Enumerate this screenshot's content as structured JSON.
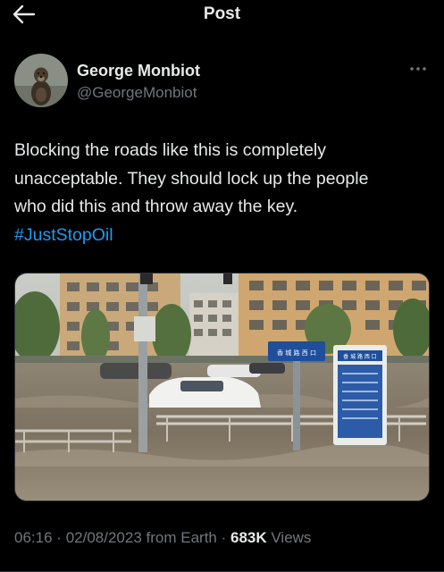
{
  "header": {
    "title": "Post",
    "back_icon": "arrow-left-icon"
  },
  "author": {
    "display_name": "George Monbiot",
    "handle": "@GeorgeMonbiot",
    "avatar_icon": "otter-avatar",
    "more_icon": "more-options-icon"
  },
  "tweet": {
    "lines": [
      "Blocking the roads like this is completely",
      "unacceptable. They should lock up the people",
      "who did this and throw away the key."
    ],
    "hashtag": "#JustStopOil"
  },
  "media": {
    "sign_left_text": "香 城 路 西 口",
    "sign_right_text": "香 城 路 西 口"
  },
  "meta": {
    "time": "06:16",
    "date": "02/08/2023",
    "source": "from Earth",
    "separator": "·",
    "views_count": "683K",
    "views_label": "Views"
  },
  "colors": {
    "background": "#000000",
    "text": "#e7e9ea",
    "secondary": "#71767b",
    "link": "#1d9bf0"
  }
}
